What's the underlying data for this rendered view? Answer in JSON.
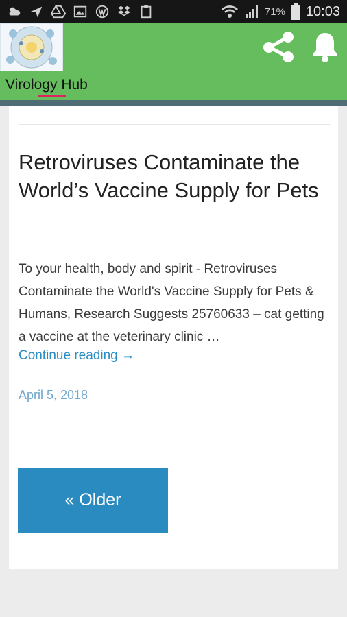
{
  "status_bar": {
    "battery_percent": "71%",
    "time": "10:03",
    "icons": [
      "weather-icon",
      "send-icon",
      "drive-icon",
      "image-icon",
      "wordpress-icon",
      "dropbox-icon",
      "clipboard-icon",
      "wifi-icon",
      "signal-icon",
      "battery-icon"
    ]
  },
  "app_bar": {
    "title": "Virology Hub",
    "accent_color": "#66bd5e",
    "actions": [
      "share-icon",
      "bell-icon"
    ]
  },
  "post": {
    "title": "Retroviruses Contaminate the World’s Vaccine Supply for Pets",
    "excerpt": "To your health, body and spirit - Retroviruses Contaminate the World's Vaccine Supply for Pets & Humans, Research Suggests 25760633 – cat getting a vaccine at the veterinary clinic …",
    "continue_label": "Continue reading →",
    "date": "April 5, 2018"
  },
  "pagination": {
    "older_label": "« Older"
  }
}
